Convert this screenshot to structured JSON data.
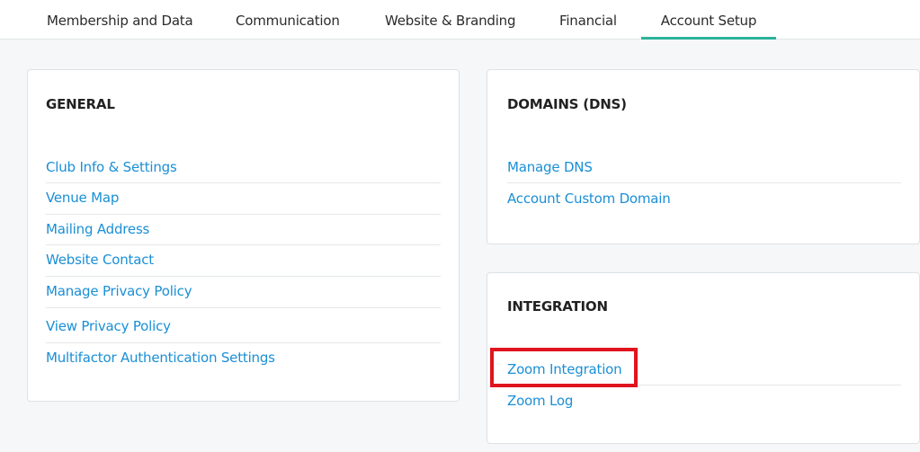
{
  "tabs": [
    {
      "label": "Membership and Data"
    },
    {
      "label": "Communication"
    },
    {
      "label": "Website & Branding"
    },
    {
      "label": "Financial"
    },
    {
      "label": "Account Setup"
    }
  ],
  "general": {
    "title": "GENERAL",
    "links": [
      "Club Info & Settings",
      "Venue Map",
      "Mailing Address",
      "Website Contact",
      "Manage Privacy Policy",
      "View Privacy Policy",
      "Multifactor Authentication Settings"
    ]
  },
  "domains": {
    "title": "DOMAINS (DNS)",
    "links": [
      "Manage DNS",
      "Account Custom Domain"
    ]
  },
  "integration": {
    "title": "INTEGRATION",
    "links": [
      "Zoom Integration",
      "Zoom Log"
    ]
  },
  "colors": {
    "link": "#1a8fd6",
    "active_tab_underline": "#2bb39a",
    "highlight_box": "#e0141e"
  }
}
